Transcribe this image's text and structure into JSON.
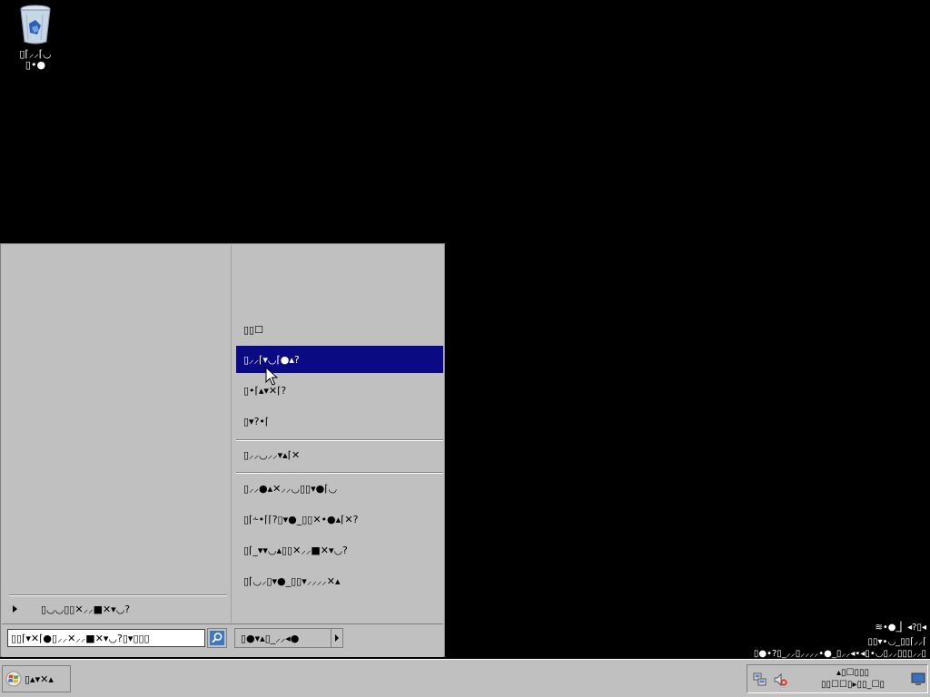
{
  "desktop": {
    "recycle_bin_label": "▯⌈⸝⸝⌈◡\n▯•●"
  },
  "start_menu": {
    "right_items": [
      {
        "label": "▯▯☐"
      },
      {
        "label": "▯⸝⸝⌈▾◡⌈●▴?"
      },
      {
        "label": "▯•⌈▴▾✕⌈?"
      },
      {
        "label": "▯▾?•⌈"
      },
      {
        "label": "▯⸝⸝◡⸝⸝▾▴⌈✕"
      },
      {
        "label": "▯⸝⸝●▴✕⸝⸝◡▯▯▾●⌈◡"
      },
      {
        "label": "▯⌈⸞•⌈⌈?▯▾●_▯▯✕•●▴⌈✕?"
      },
      {
        "label": "▯⌈_▾▾◡▴▯▯✕⸝⸝■✕▾◡?"
      },
      {
        "label": "▯⌈◡⸝▯▾●_▯▯▾⸝⸝⸝⸝✕▴"
      }
    ],
    "selected_index": 1,
    "all_programs_label": "▯◡◡▯▯✕⸝⸝■✕▾◡?",
    "search": {
      "value": "▯▯⌈▾✕⌈●▯⸝⸝✕⸝⸝■✕▾◡?▯▾▯▯▯"
    },
    "shutdown_label": "▯●▾▴▯_⸝⸝◂●"
  },
  "watermark": {
    "line1": "≋•●_▏◂?▯◂",
    "line2": "▯▯▾•◡_▯▯⌈⸝⸝⌈",
    "line3": "▯●•?▯_⸝⸝▯⸝⸝⸝⸝•●_▯⸝⸝◂•◂▯•◡▯⸝⸝▯▯▯⸝⸝▯"
  },
  "taskbar": {
    "start_label": "▯▴▾✕▴",
    "clock_line1": "▴▯☐▯▯▯",
    "clock_line2": "▯▯☐☐▯▸▯▯_☐▯"
  }
}
